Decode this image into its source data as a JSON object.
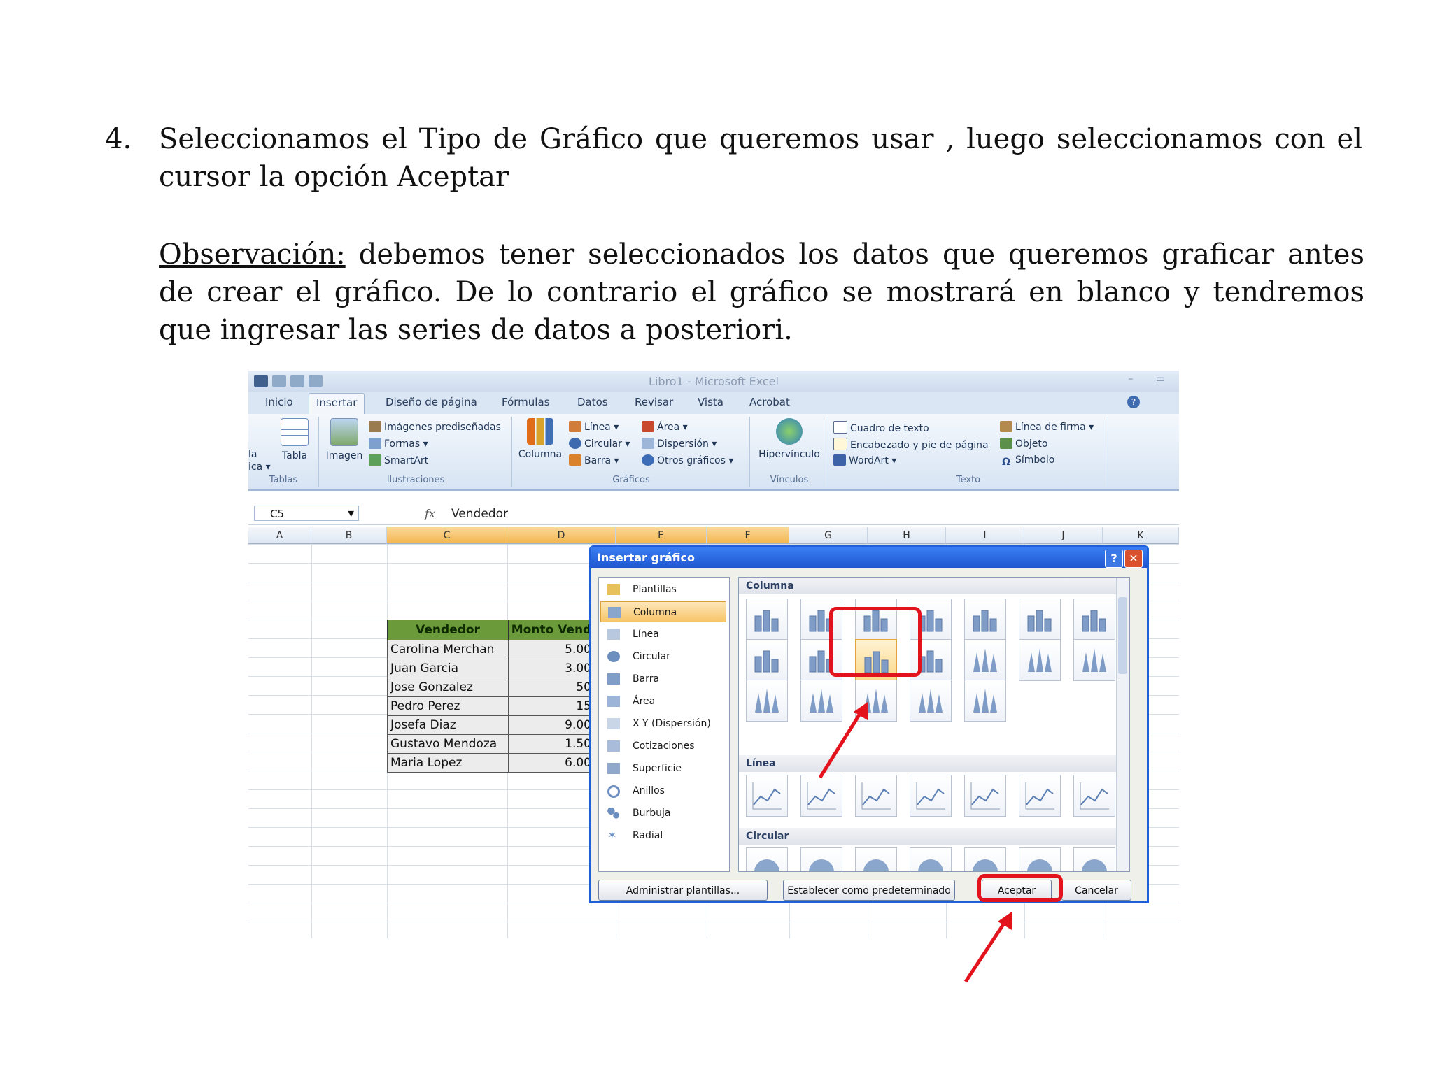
{
  "instructions": {
    "step_number": "4.",
    "step_text": "Seleccionamos el Tipo de  Gráfico que queremos usar , luego seleccionamos con el cursor la opción Aceptar",
    "observation_label": "Observación:",
    "observation_text": " debemos tener seleccionados los datos que queremos graficar antes de crear el gráfico. De lo contrario el gráfico se mostrará en blanco y tendremos que ingresar las series de datos a posteriori."
  },
  "excel": {
    "window_title": "Libro1 - Microsoft Excel",
    "tabs": [
      "Inicio",
      "Insertar",
      "Diseño de página",
      "Fórmulas",
      "Datos",
      "Revisar",
      "Vista",
      "Acrobat"
    ],
    "active_tab": "Insertar",
    "ribbon": {
      "tablas": {
        "partial_labels": [
          "la",
          "ica ▾"
        ],
        "tabla": "Tabla",
        "group": "Tablas"
      },
      "ilustraciones": {
        "imagen": "Imagen",
        "imagenes": "Imágenes prediseñadas",
        "formas": "Formas ▾",
        "smartart": "SmartArt",
        "group": "Ilustraciones"
      },
      "graficos": {
        "columna": "Columna",
        "linea": "Línea ▾",
        "circular": "Circular ▾",
        "barra": "Barra ▾",
        "area": "Área ▾",
        "dispersion": "Dispersión ▾",
        "otros": "Otros gráficos ▾",
        "group": "Gráficos"
      },
      "vinculos": {
        "hipervinculo": "Hipervínculo",
        "group": "Vínculos"
      },
      "texto": {
        "cuadro": "Cuadro de texto",
        "encabezado": "Encabezado y pie de página",
        "wordart": "WordArt ▾",
        "linea_firma": "Línea de firma ▾",
        "objeto": "Objeto",
        "simbolo": "Símbolo",
        "group": "Texto"
      }
    },
    "name_box": "C5",
    "fx": "fx",
    "formula_value": "Vendedor",
    "columns": [
      "A",
      "B",
      "C",
      "D",
      "E",
      "F",
      "G",
      "H",
      "I",
      "J",
      "K"
    ],
    "table": {
      "headers": [
        "Vendedor",
        "Monto Vend"
      ],
      "rows": [
        [
          "Carolina Merchan",
          "5.00"
        ],
        [
          "Juan Garcia",
          "3.00"
        ],
        [
          "Jose Gonzalez",
          "50"
        ],
        [
          "Pedro Perez",
          "15"
        ],
        [
          "Josefa Diaz",
          "9.00"
        ],
        [
          "Gustavo Mendoza",
          "1.50"
        ],
        [
          "Maria Lopez",
          "6.00"
        ]
      ]
    }
  },
  "dialog": {
    "title": "Insertar gráfico",
    "help": "?",
    "close": "✕",
    "categories": [
      "Plantillas",
      "Columna",
      "Línea",
      "Circular",
      "Barra",
      "Área",
      "X Y (Dispersión)",
      "Cotizaciones",
      "Superficie",
      "Anillos",
      "Burbuja",
      "Radial"
    ],
    "selected_category": "Columna",
    "sections": [
      "Columna",
      "Línea",
      "Circular"
    ],
    "buttons": {
      "manage": "Administrar plantillas...",
      "default": "Establecer como predeterminado",
      "ok": "Aceptar",
      "cancel": "Cancelar"
    }
  },
  "colors": {
    "highlight": "#e3131e",
    "header_green": "#6b9a3a",
    "dialog_blue": "#1e56cf"
  }
}
